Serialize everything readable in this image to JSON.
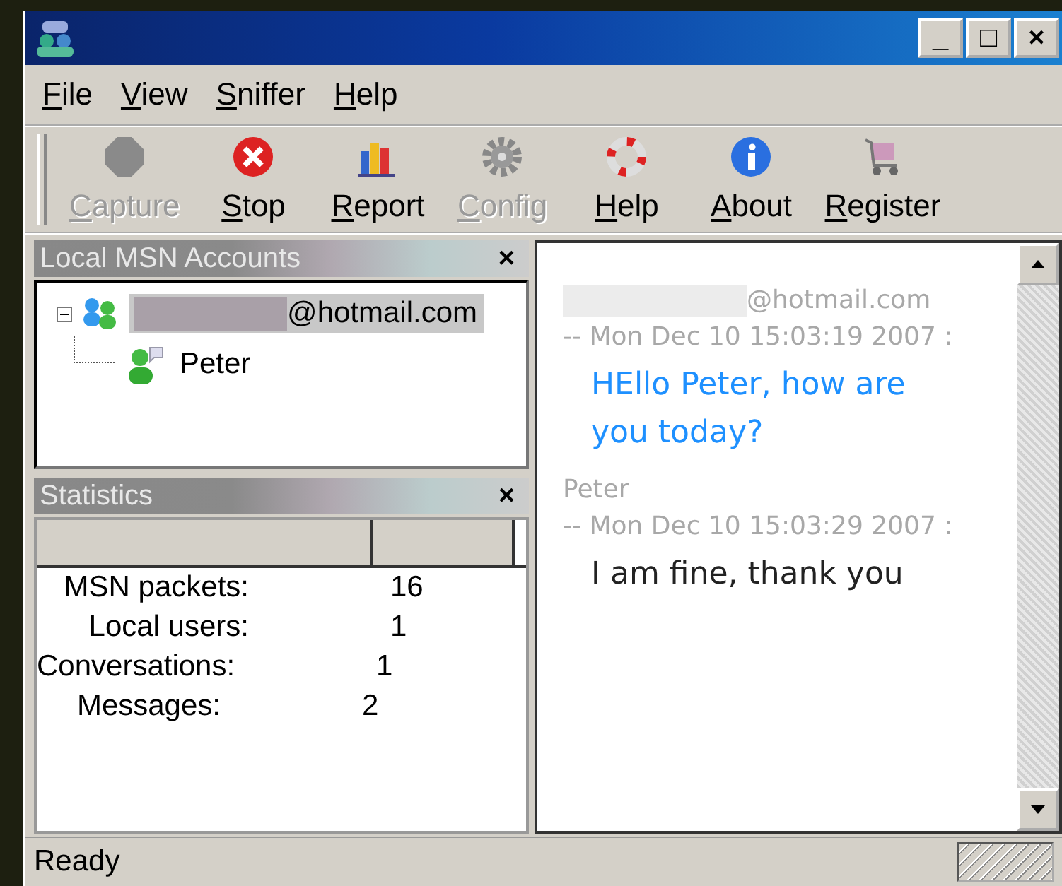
{
  "window": {
    "controls": [
      "_",
      "□",
      "×"
    ]
  },
  "menu": [
    "File",
    "View",
    "Sniffer",
    "Help"
  ],
  "toolbar": [
    {
      "label": "Capture",
      "disabled": true
    },
    {
      "label": "Stop",
      "disabled": false
    },
    {
      "label": "Report",
      "disabled": false
    },
    {
      "label": "Config",
      "disabled": true
    },
    {
      "label": "Help",
      "disabled": false
    },
    {
      "label": "About",
      "disabled": false
    },
    {
      "label": "Register",
      "disabled": false
    }
  ],
  "accounts_panel": {
    "title": "Local MSN Accounts",
    "close": "×",
    "tree": [
      {
        "label": "@hotmail.com",
        "redacted": true,
        "expanded": true,
        "selected": true,
        "children": [
          {
            "label": "Peter",
            "selected": false
          }
        ]
      }
    ]
  },
  "statistics_panel": {
    "title": "Statistics",
    "close": "×",
    "rows": [
      {
        "label": "MSN packets:",
        "value": "16"
      },
      {
        "label": "Local users:",
        "value": "1"
      },
      {
        "label": "Conversations:",
        "value": "1"
      },
      {
        "label": "Messages:",
        "value": "2"
      }
    ]
  },
  "chat": [
    {
      "sender": "@hotmail.com",
      "redacted": true,
      "time": "-- Mon Dec 10 15:03:19 2007 :",
      "body": "HEllo Peter, how are you today?",
      "color": "#1e90ff"
    },
    {
      "sender": "Peter",
      "redacted": false,
      "time": "-- Mon Dec 10 15:03:29 2007 :",
      "body": "I am fine, thank you",
      "color": "#222222"
    }
  ],
  "status_bar": "Ready"
}
